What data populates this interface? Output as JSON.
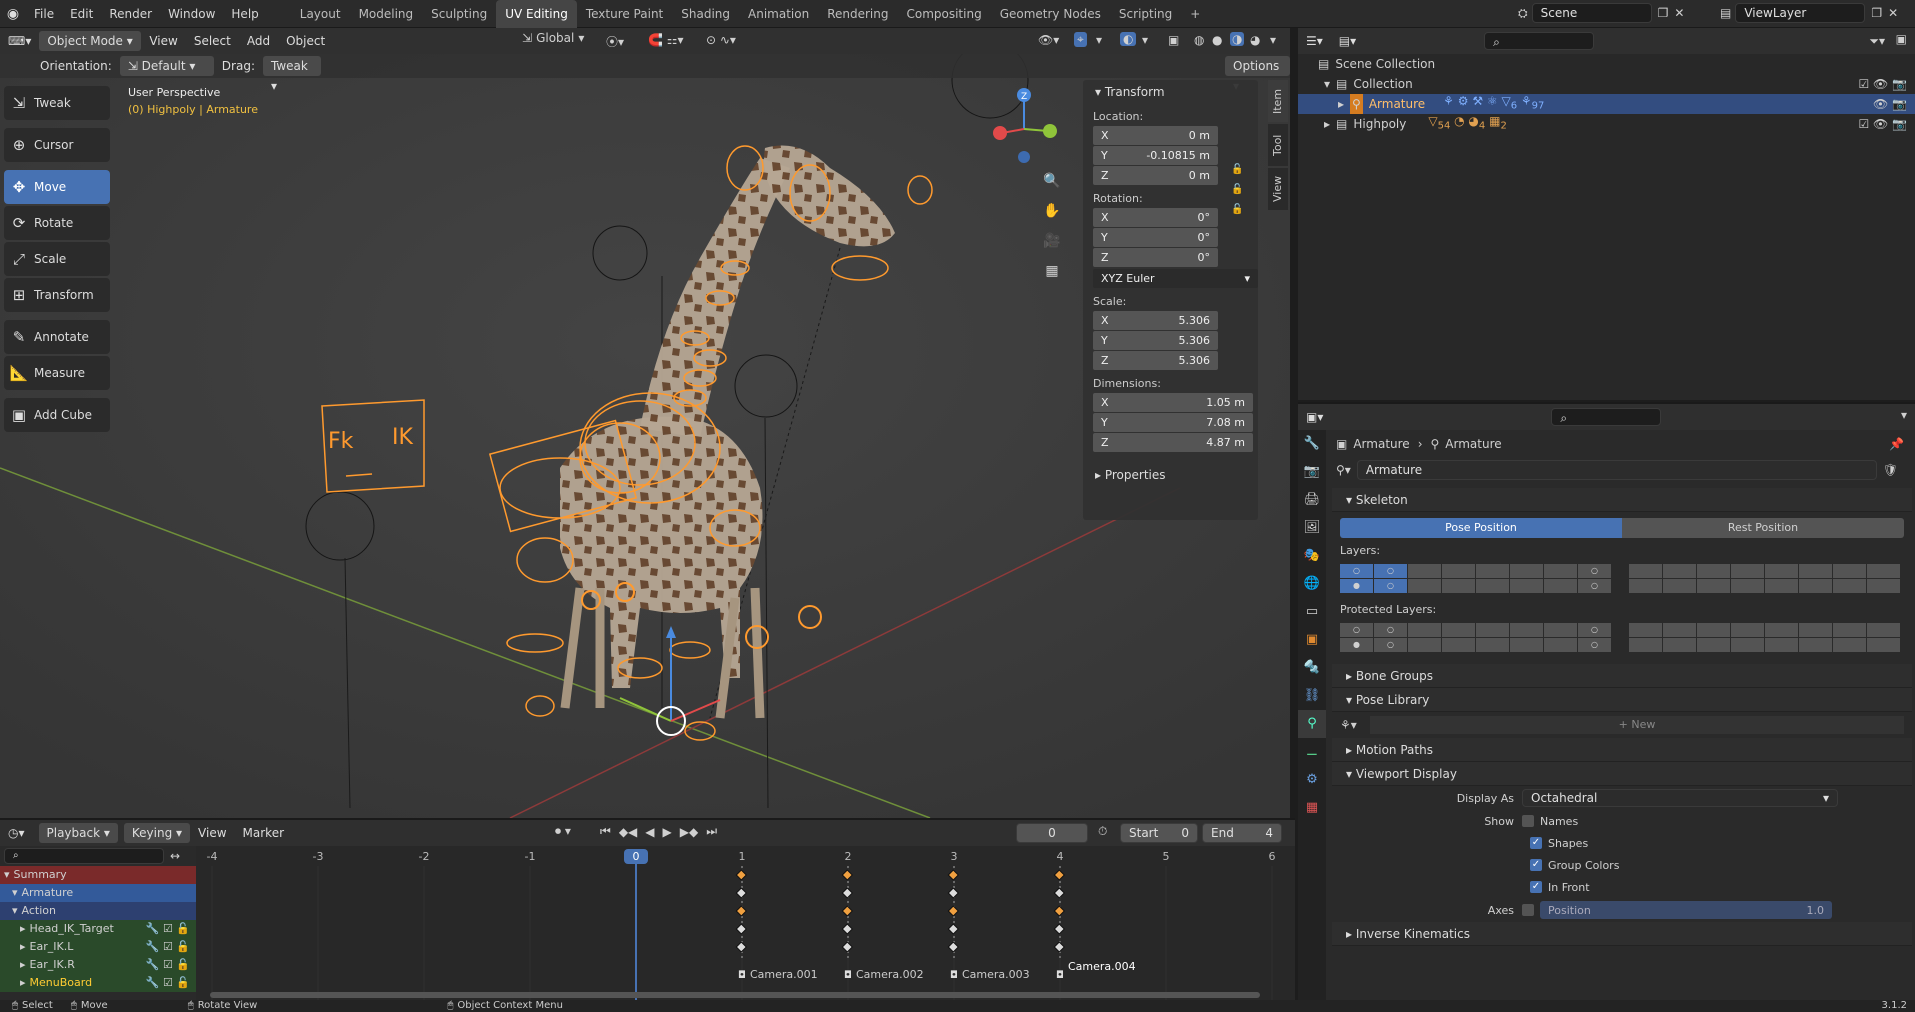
{
  "topbar": {
    "menus": [
      "File",
      "Edit",
      "Render",
      "Window",
      "Help"
    ],
    "workspaces": [
      "Layout",
      "Modeling",
      "Sculpting",
      "UV Editing",
      "Texture Paint",
      "Shading",
      "Animation",
      "Rendering",
      "Compositing",
      "Geometry Nodes",
      "Scripting"
    ],
    "active_workspace": "UV Editing",
    "scene": "Scene",
    "view_layer": "ViewLayer"
  },
  "viewport": {
    "mode": "Object Mode",
    "menus": [
      "View",
      "Select",
      "Add",
      "Object"
    ],
    "orientation_label": "Orientation:",
    "orientation_value": "Default",
    "drag_label": "Drag:",
    "drag_value": "Tweak",
    "transform_space": "Global",
    "options_label": "Options",
    "overlay_title": "User Perspective",
    "overlay_subtitle": "(0) Highpoly | Armature",
    "board_text_left": "Fk",
    "board_text_right": "IK"
  },
  "toolbar": {
    "tools": [
      {
        "label": "Tweak",
        "icon": "⇲"
      },
      {
        "label": "Cursor",
        "icon": "⊕"
      },
      {
        "label": "Move",
        "icon": "✥"
      },
      {
        "label": "Rotate",
        "icon": "⟳"
      },
      {
        "label": "Scale",
        "icon": "⤢"
      },
      {
        "label": "Transform",
        "icon": "⊞"
      },
      {
        "label": "Annotate",
        "icon": "✎"
      },
      {
        "label": "Measure",
        "icon": "📐"
      },
      {
        "label": "Add Cube",
        "icon": "▣"
      }
    ],
    "active_tool": "Move"
  },
  "npanel": {
    "title": "Transform",
    "location_label": "Location:",
    "location": {
      "x": "0 m",
      "y": "-0.10815 m",
      "z": "0 m"
    },
    "rotation_label": "Rotation:",
    "rotation": {
      "x": "0°",
      "y": "0°",
      "z": "0°"
    },
    "rotation_mode": "XYZ Euler",
    "scale_label": "Scale:",
    "scale": {
      "x": "5.306",
      "y": "5.306",
      "z": "5.306"
    },
    "dimensions_label": "Dimensions:",
    "dimensions": {
      "x": "1.05 m",
      "y": "7.08 m",
      "z": "4.87 m"
    },
    "properties_label": "Properties",
    "tabs": [
      "Item",
      "Tool",
      "View"
    ]
  },
  "timeline": {
    "menus": [
      "Playback",
      "Keying",
      "View",
      "Marker"
    ],
    "current_frame": "0",
    "start_label": "Start",
    "start": "0",
    "end_label": "End",
    "end": "4",
    "ruler": [
      "-4",
      "-3",
      "-2",
      "-1",
      "0",
      "1",
      "2",
      "3",
      "4",
      "5",
      "6"
    ],
    "channels": [
      {
        "label": "Summary",
        "type": "summary"
      },
      {
        "label": "Armature",
        "type": "object"
      },
      {
        "label": "Action",
        "type": "action"
      },
      {
        "label": "Head_IK_Target",
        "type": "group"
      },
      {
        "label": "Ear_IK.L",
        "type": "group"
      },
      {
        "label": "Ear_IK.R",
        "type": "group"
      },
      {
        "label": "MenuBoard",
        "type": "group"
      }
    ],
    "markers": [
      "Camera.001",
      "Camera.002",
      "Camera.003",
      "Camera.004"
    ]
  },
  "statusbar": {
    "items": [
      "Select",
      "Move",
      "Rotate View",
      "Object Context Menu"
    ],
    "version": "3.1.2"
  },
  "outliner": {
    "root": "Scene Collection",
    "collection": "Collection",
    "armature": "Armature",
    "armature_counts": [
      "6",
      "97"
    ],
    "highpoly": "Highpoly",
    "highpoly_counts": [
      "54",
      "4",
      "2"
    ]
  },
  "properties": {
    "breadcrumb_object": "Armature",
    "breadcrumb_data": "Armature",
    "data_name": "Armature",
    "skeleton_label": "Skeleton",
    "pose_position": "Pose Position",
    "rest_position": "Rest Position",
    "layers_label": "Layers:",
    "protected_layers_label": "Protected Layers:",
    "bone_groups": "Bone Groups",
    "pose_library": "Pose Library",
    "new_label": "New",
    "motion_paths": "Motion Paths",
    "viewport_display": "Viewport Display",
    "display_as_label": "Display As",
    "display_as_value": "Octahedral",
    "show_label": "Show",
    "names_label": "Names",
    "shapes_label": "Shapes",
    "group_colors_label": "Group Colors",
    "in_front_label": "In Front",
    "axes_label": "Axes",
    "axes_position_label": "Position",
    "axes_position_value": "1.0",
    "inverse_kinematics": "Inverse Kinematics"
  }
}
